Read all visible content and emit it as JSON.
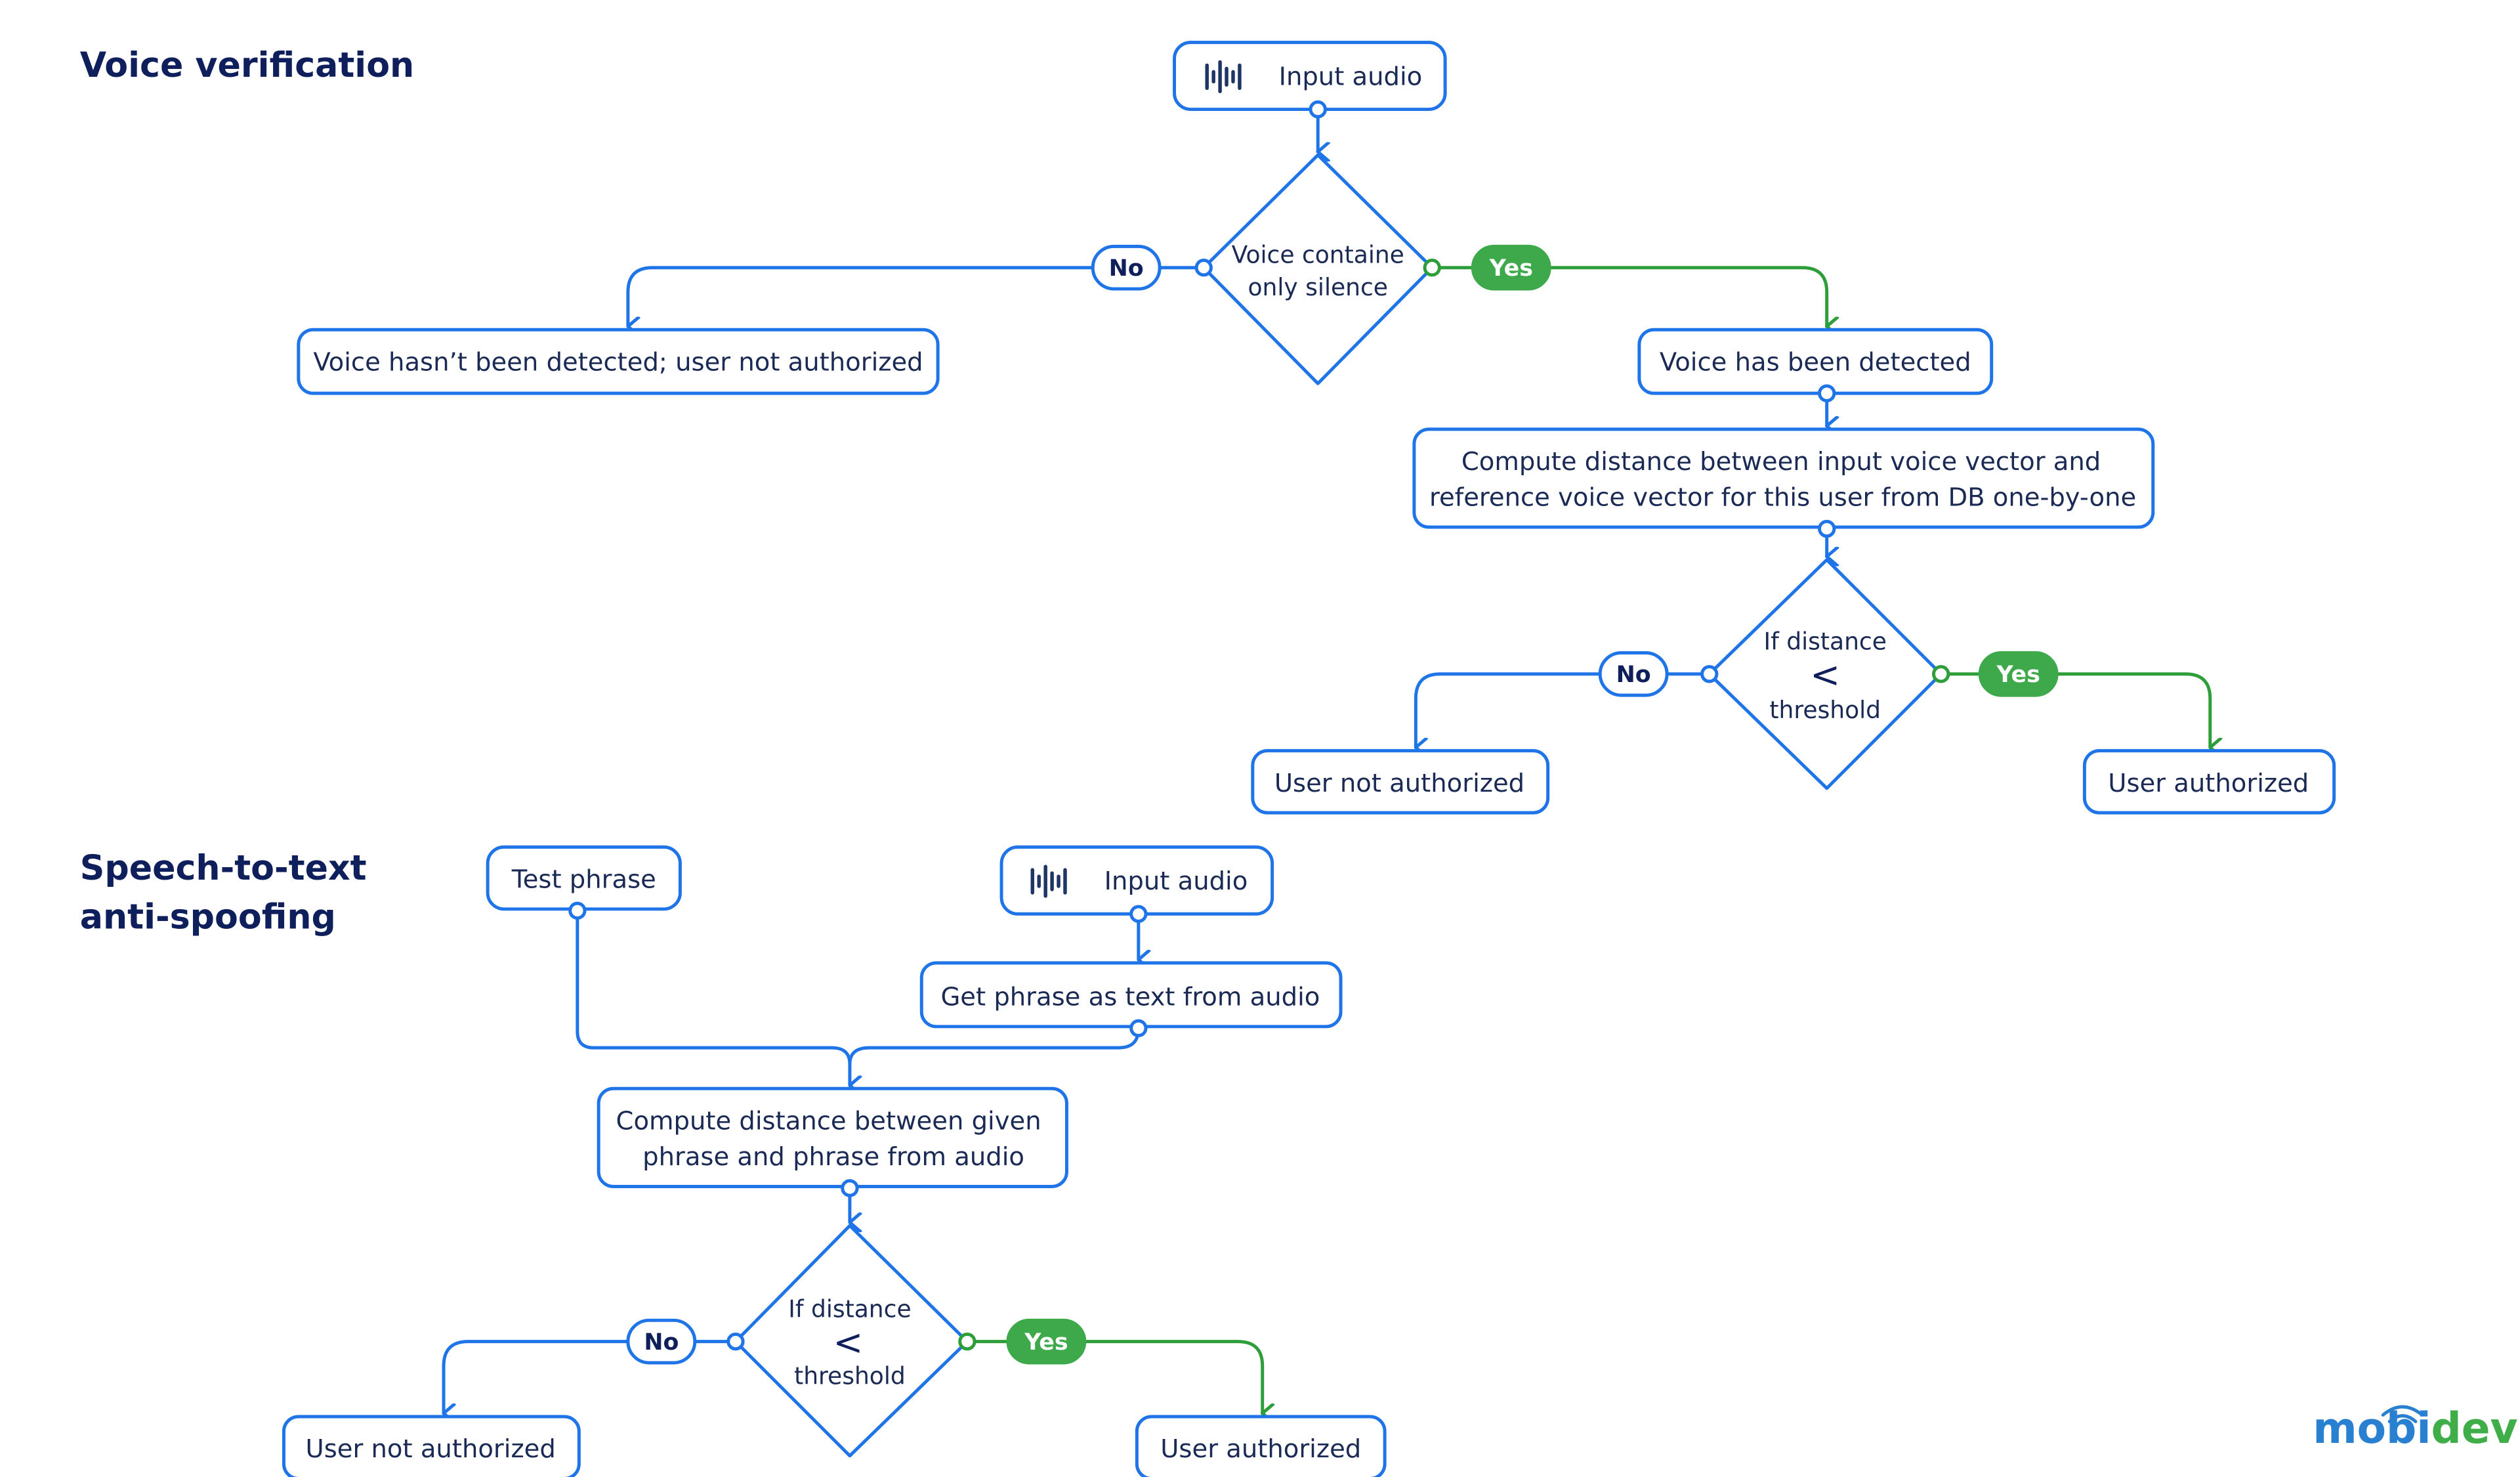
{
  "sections": {
    "voice_verification": {
      "title": "Voice verification",
      "input_audio": {
        "label": "Input audio",
        "icon": "audio-waveform-icon"
      },
      "silence_check": {
        "line1": "Voice containe",
        "line2": "only silence"
      },
      "no_label": "No",
      "yes_label": "Yes",
      "not_detected": "Voice hasn’t been detected; user not authorized",
      "detected": "Voice has been detected",
      "compute": {
        "line1": "Compute distance between input voice vector and",
        "line2": "reference voice vector for this user from DB one-by-one"
      },
      "threshold_check": {
        "line1": "If distance",
        "op": "<",
        "line2": "threshold"
      },
      "no_label_2": "No",
      "yes_label_2": "Yes",
      "not_authorized": "User not authorized",
      "authorized": "User authorized"
    },
    "anti_spoofing": {
      "title_line1": "Speech-to-text",
      "title_line2": "anti-spoofing",
      "test_phrase": "Test phrase",
      "input_audio": {
        "label": "Input audio",
        "icon": "audio-waveform-icon"
      },
      "get_phrase": "Get phrase as text from audio",
      "compute": {
        "line1": "Compute distance between given",
        "line2": "phrase and phrase from audio"
      },
      "threshold_check": {
        "line1": "If distance",
        "op": "<",
        "line2": "threshold"
      },
      "no_label": "No",
      "yes_label": "Yes",
      "not_authorized": "User not authorized",
      "authorized": "User authorized"
    }
  },
  "logo": {
    "part1": "mobi",
    "part2": "dev"
  },
  "colors": {
    "node_stroke": "#1f74e8",
    "yes_green": "#3da94b",
    "title_navy": "#0f1f5c",
    "text_navy": "#1a2a55"
  }
}
